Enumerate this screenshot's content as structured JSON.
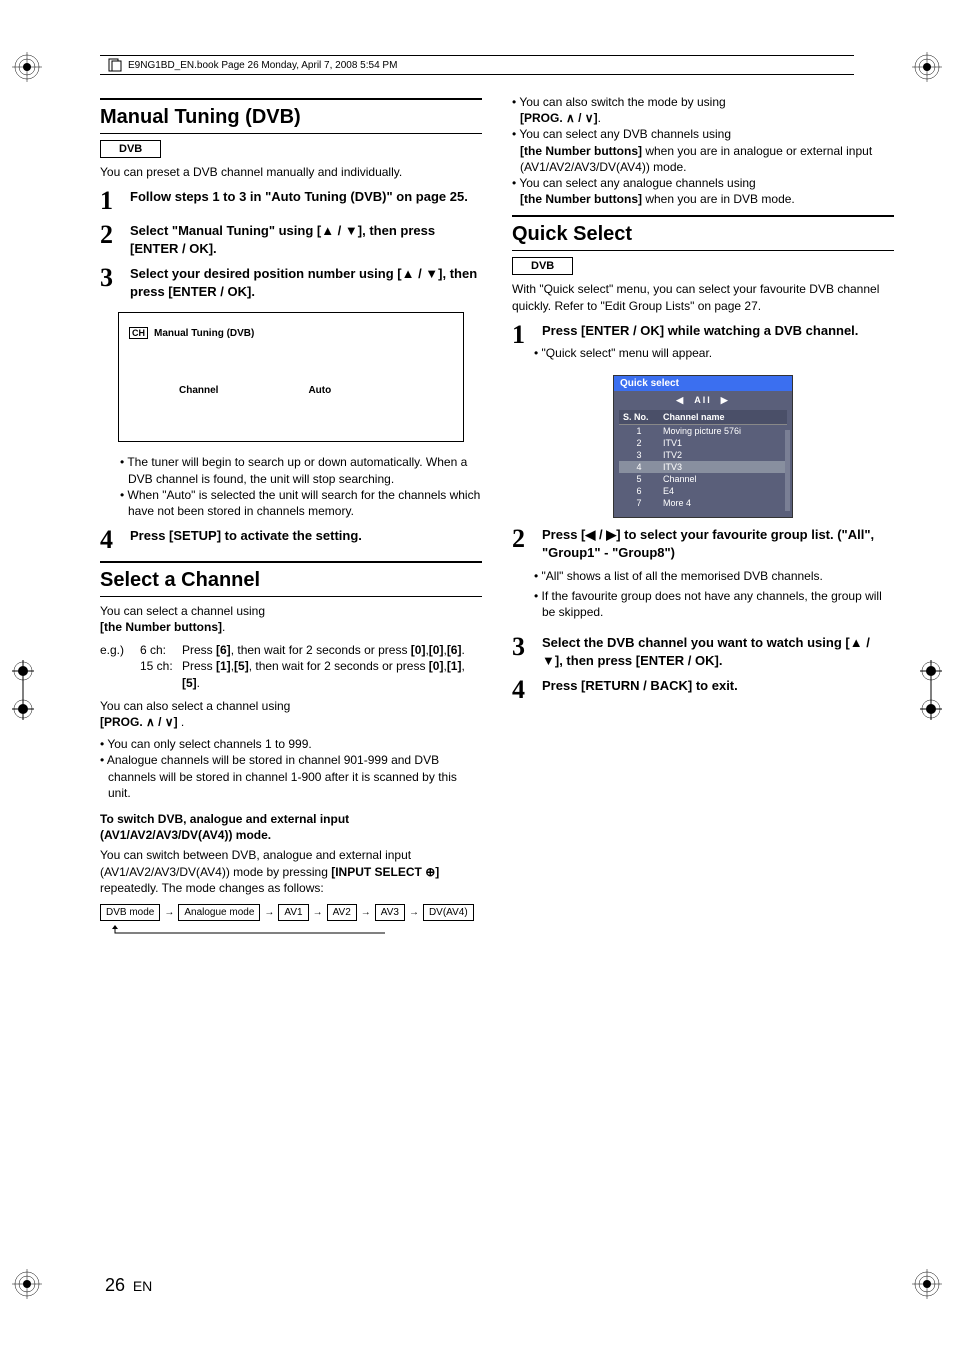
{
  "header": {
    "text": "E9NG1BD_EN.book  Page 26  Monday, April 7, 2008  5:54 PM"
  },
  "col1": {
    "s1": {
      "title": "Manual Tuning (DVB)",
      "badge": "DVB",
      "intro": "You can preset a DVB channel manually and individually.",
      "step1": "Follow steps 1 to 3 in \"Auto Tuning (DVB)\" on page 25.",
      "step2": "Select \"Manual Tuning\" using [▲ / ▼], then press [ENTER / OK].",
      "step3": "Select your desired position number using [▲ / ▼], then press [ENTER / OK].",
      "panel": {
        "title": "Manual Tuning (DVB)",
        "ch": "CH",
        "col_channel": "Channel",
        "col_auto": "Auto"
      },
      "b1": "The tuner will begin to search up or down automatically. When a DVB channel is found, the unit will stop searching.",
      "b2": "When \"Auto\" is selected the unit will search for the channels which have not been stored in channels memory.",
      "step4": "Press [SETUP] to activate the setting."
    },
    "s2": {
      "title": "Select a Channel",
      "p1a": "You can select a channel using",
      "p1b": "[the Number buttons]",
      "eg": "e.g.)",
      "eg1a": "6 ch:",
      "eg1b_pre": "Press ",
      "eg1b_k": "[6]",
      "eg1b_post": ", then wait for 2 seconds or press ",
      "eg1b_k2": "[0]",
      "eg1b_c": ",",
      "eg1b_k3": "[0]",
      "eg1b_k4": "[6]",
      "eg2a": "15 ch:",
      "eg2b_pre": "Press ",
      "eg2b_k": "[1]",
      "eg2b_k2": "[5]",
      "eg2b_post": ", then wait for 2 seconds or press ",
      "eg2b_k3": "[0]",
      "eg2b_k4": "[1]",
      "eg2b_k5": "[5]",
      "p2a": "You can also select a channel using",
      "p2b": "[PROG. ∧ / ∨]",
      "b1": "You can only select channels 1 to 999.",
      "b2": "Analogue channels will be stored in channel 901-999 and DVB channels will be stored in channel 1-900 after it is scanned by this unit.",
      "subhead": "To switch DVB, analogue and external input (AV1/AV2/AV3/DV(AV4)) mode.",
      "p3a": "You can switch between DVB, analogue and external input (AV1/AV2/AV3/DV(AV4)) mode by pressing ",
      "p3b": "[INPUT SELECT ⊕]",
      "p3c": " repeatedly. The mode changes as follows:",
      "flow": {
        "m1": "DVB mode",
        "m2": "Analogue mode",
        "m3": "AV1",
        "m4": "AV2",
        "m5": "AV3",
        "m6": "DV(AV4)"
      }
    }
  },
  "col2": {
    "top": {
      "b1a": "You can also switch the mode by using ",
      "b1b": "[PROG. ∧ / ∨]",
      "b2a": "You can select any DVB channels using ",
      "b2b": "[the Number buttons]",
      "b2c": " when you are in analogue or external input (AV1/AV2/AV3/DV(AV4)) mode.",
      "b3a": "You can select any analogue channels using ",
      "b3b": "[the Number buttons]",
      "b3c": " when you are in DVB mode."
    },
    "qs": {
      "title": "Quick Select",
      "badge": "DVB",
      "intro": "With \"Quick select\" menu, you can select your favourite DVB channel quickly. Refer to \"Edit Group Lists\" on page 27.",
      "step1": "Press [ENTER / OK] while watching a DVB channel.",
      "s1sub": "\"Quick select\" menu will appear.",
      "panel": {
        "title": "Quick select",
        "tab": "All",
        "h1": "S. No.",
        "h2": "Channel name",
        "rows": [
          {
            "n": "1",
            "name": "Moving picture 576i"
          },
          {
            "n": "2",
            "name": "ITV1"
          },
          {
            "n": "3",
            "name": "ITV2"
          },
          {
            "n": "4",
            "name": "ITV3"
          },
          {
            "n": "5",
            "name": "Channel"
          },
          {
            "n": "6",
            "name": "E4"
          },
          {
            "n": "7",
            "name": "More 4"
          }
        ]
      },
      "step2": "Press [◀ / ▶] to select your favourite group list. (\"All\", \"Group1\" - \"Group8\")",
      "s2b1": "\"All\" shows a list of all the memorised DVB channels.",
      "s2b2": "If the favourite group does not have any channels, the group will be skipped.",
      "step3": "Select the DVB channel you want to watch using [▲ / ▼], then press [ENTER / OK].",
      "step4": "Press [RETURN / BACK] to exit."
    }
  },
  "footer": {
    "page": "26",
    "lang": "EN"
  }
}
